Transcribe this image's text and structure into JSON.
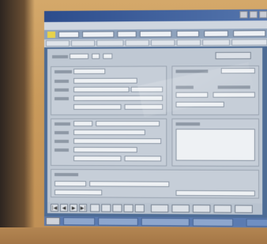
{
  "window": {
    "title": "",
    "menu": ""
  },
  "colors": {
    "titlebar": "#2c4c8c",
    "window_bg": "#bfc8d3",
    "taskbar": "#5b7bb1",
    "toolbar_accent": "#e7d24a",
    "monitor_bezel": "#c99a5b"
  },
  "navigation": {
    "first": "|◀",
    "prev": "◀",
    "next": "▶",
    "last": "▶|"
  },
  "icons": [
    "app-icon",
    "minimize-icon",
    "maximize-icon",
    "close-icon",
    "first-record-icon",
    "prev-record-icon",
    "next-record-icon",
    "last-record-icon",
    "start-icon"
  ]
}
